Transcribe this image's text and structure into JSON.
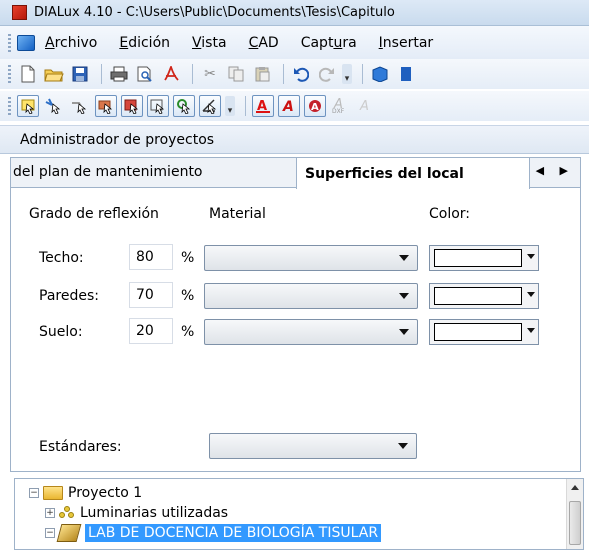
{
  "window": {
    "title": "DIALux 4.10 - C:\\Users\\Public\\Documents\\Tesis\\Capitulo"
  },
  "menubar": {
    "items": [
      {
        "accel": "A",
        "rest": "rchivo"
      },
      {
        "accel": "E",
        "rest": "dición"
      },
      {
        "accel": "V",
        "rest": "ista"
      },
      {
        "accel": "C",
        "rest": "AD"
      },
      {
        "pre": "Capt",
        "accel": "u",
        "rest": "ra"
      },
      {
        "accel": "I",
        "rest": "nsertar"
      }
    ]
  },
  "project_manager": {
    "header": "Administrador de proyectos"
  },
  "tabs": {
    "inactive_label": "del plan de mantenimiento",
    "active_label": "Superficies del local",
    "nav_glyphs": "◀ ▶"
  },
  "surfaces": {
    "col_reflection": "Grado de reflexión",
    "col_material": "Material",
    "col_color": "Color:",
    "percent_sign": "%",
    "rows": [
      {
        "label": "Techo:",
        "value": "80",
        "swatch_color": "#ffffff"
      },
      {
        "label": "Paredes:",
        "value": "70",
        "swatch_color": "#ffffff"
      },
      {
        "label": "Suelo:",
        "value": "20",
        "swatch_color": "#ffffff"
      }
    ],
    "standards_label": "Estándares:"
  },
  "tree": {
    "project": "Proyecto 1",
    "luminaires": "Luminarias utilizadas",
    "room": "LAB DE DOCENCIA DE BIOLOGÍA TISULAR"
  },
  "colors": {
    "selection": "#3399ff",
    "titlebar": "#dde9f6"
  }
}
